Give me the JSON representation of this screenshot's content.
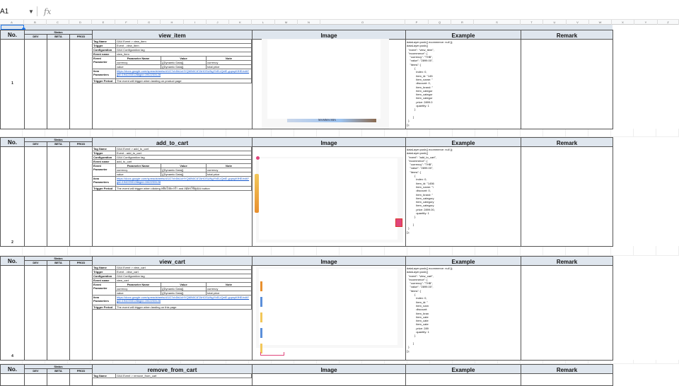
{
  "formula_bar": {
    "cell_ref": "A1",
    "fx_label": "fx"
  },
  "columns": [
    "A",
    "B",
    "C",
    "D",
    "E",
    "F",
    "G",
    "H",
    "I",
    "J",
    "K",
    "L",
    "M",
    "N",
    "O",
    "P",
    "Q",
    "R",
    "S",
    "T",
    "U",
    "V",
    "W",
    "X",
    "Y",
    "Z"
  ],
  "headers": {
    "no": "No.",
    "status": "Status",
    "dev": "DEV",
    "beta": "BETA",
    "prod": "PROD",
    "image": "Image",
    "example": "Example",
    "remark": "Remark"
  },
  "labels": {
    "tag_name": "Tag Name",
    "trigger": "Trigger",
    "configuration": "Configuration",
    "event_name": "Event name",
    "event_parameter": "Event Parameter",
    "param_name": "Parameter Name",
    "value": "Value",
    "note": "Note",
    "item_parameters": "Item Parameters",
    "trigger_period": "Trigger Period"
  },
  "blocks": [
    {
      "no": "1",
      "title": "view_item",
      "tag_name": "GA4 Event > view_item",
      "trigger": "Event - view_item",
      "configuration": "GA4 Configuration tag",
      "event_name": "view_item",
      "params": [
        {
          "name": "currency",
          "value": "{{Dynamic Data}}",
          "note": "currency"
        },
        {
          "name": "value",
          "value": "{{Dynamic Data}}",
          "note": "total price"
        }
      ],
      "item_parameters_link": "https://docs.google.com/spreadsheets/d/1G7xh5hUcHYQMN0C6TAHOSUNgYhELiQeiE-yppsyKfHE/edit?gid=1942233128#gid=1942233128",
      "trigger_period": "The event will trigger when landing on product page",
      "image_caption": "MAMMA MIA",
      "example": "dataLayer.push({ ecommerce: null });\ndataLayer.push({\n  \"event\": \"view_item\",\n  \"ecommerce\": {\n    \"currency\": \"THB\",\n    \"value\": \"2899.00\",\n    \"items\": [\n          {\n            index: 0,\n            item_id: \"145\n            item_name: \"\n            discount: 0,\n            item_brand: \"\n            item_categor\n            item_categor\n            item_categor\n            price: 2899.0\n            quantity: 1\n          }\n\n        ]\n  }\n});",
      "remark": ""
    },
    {
      "no": "2",
      "title": "add_to_cart",
      "tag_name": "GA4 Event > add_to_cart",
      "trigger": "Event - add_to_cart",
      "configuration": "GA4 Configuration tag",
      "event_name": "add_to_cart",
      "params": [
        {
          "name": "currency",
          "value": "{{Dynamic Data}}",
          "note": "currency"
        },
        {
          "name": "value",
          "value": "{{Dynamic Data}}",
          "note": "total price"
        }
      ],
      "item_parameters_link": "https://docs.google.com/spreadsheets/d/1G7xh5hUcHYQMN0C6TAHOSUNgYhELiQeiE-yppsyKfHE/edit?gid=1942233128#gid=1942233128",
      "trigger_period": "The event will trigger when clicking หยิบใส่ตะกร้า and สมัครใช้คูปอง button",
      "image_caption": "",
      "example": "dataLayer.push({ ecommerce: null });\ndataLayer.push({\n  \"event\": \"add_to_cart\",\n  \"ecommerce\": {\n    \"currency\": \"THB\",\n    \"value\": \"2899.00\",\n    \"items\": [\n          {\n            index: 0,\n            item_id: \"1456\n            item_name: \"\\\n            discount: 0,\n            item_brand: \"\n            item_category\n            item_category\n            item_category\n            price: 2899.00,\n            quantity: 1\n          }\n\n        ]\n  }\n});",
      "remark": ""
    },
    {
      "no": "4",
      "title": "view_cart",
      "tag_name": "GA4 Event > view_cart",
      "trigger": "Event - view_cart",
      "configuration": "GA4 Configuration tag",
      "event_name": "view_cart",
      "params": [
        {
          "name": "currency",
          "value": "{{Dynamic Data}}",
          "note": "currency"
        },
        {
          "name": "value",
          "value": "{{Dynamic Data}}",
          "note": "total price"
        }
      ],
      "item_parameters_link": "https://docs.google.com/spreadsheets/d/1G7xh5hUcHYQMN0C6TAHOSUNgYhELiQeiE-yppsyKfHE/edit?gid=1942233128#gid=1942233128",
      "trigger_period": "The event will trigger when landing on this page",
      "image_caption": "",
      "example": "dataLayer.push({ ecommerce: null });\ndataLayer.push({\n  \"event\": \"view_cart\",\n  \"ecommerce\": {\n    \"currency\": \"THB\",\n    \"value\": \"2899.00\",\n    \"items\": [\n          {\n            index: 0,\n            item_id: \"\n            item_nam\n            discount:\n            item_bran\n            item_cate\n            item_cate\n            item_cate\n            price: 289\n            quantity: 1\n          }\n\n        ]\n  }\n});",
      "remark": ""
    },
    {
      "no": "",
      "title": "remove_from_cart",
      "tag_name": "GA4 Event > remove_from_cart"
    }
  ]
}
